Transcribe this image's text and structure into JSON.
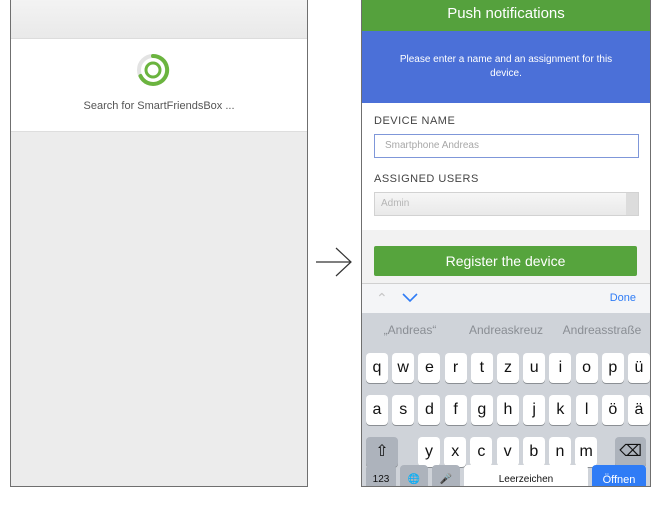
{
  "left_screen": {
    "search_text": "Search for SmartFriendsBox ..."
  },
  "right_screen": {
    "header_title": "Push notifications",
    "info_text": "Please enter a name and an assignment for this device.",
    "device_name_label": "DEVICE NAME",
    "device_name_placeholder": "Smartphone Andreas",
    "assigned_users_label": "ASSIGNED USERS",
    "assigned_users_value": "Admin",
    "register_button": "Register the device",
    "accessory": {
      "done_label": "Done",
      "up_icon": "chevron-up-icon",
      "down_icon": "chevron-down-icon"
    },
    "suggestions": [
      "„Andreas“",
      "Andreaskreuz",
      "Andreasstraße"
    ],
    "keyboard": {
      "row1": [
        "q",
        "w",
        "e",
        "r",
        "t",
        "z",
        "u",
        "i",
        "o",
        "p",
        "ü"
      ],
      "row2": [
        "a",
        "s",
        "d",
        "f",
        "g",
        "h",
        "j",
        "k",
        "l",
        "ö",
        "ä"
      ],
      "row3": [
        "y",
        "x",
        "c",
        "v",
        "b",
        "n",
        "m"
      ],
      "numbers_key": "123",
      "space_key": "Leerzeichen",
      "return_key": "Öffnen"
    }
  },
  "colors": {
    "header_green": "#55a13d",
    "info_blue": "#4b70d8",
    "button_green": "#56a43d",
    "ios_blue": "#2f7cf6"
  }
}
